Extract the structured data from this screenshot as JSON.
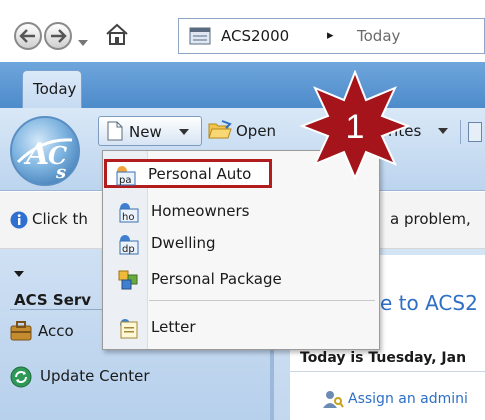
{
  "address_bar": {
    "app": "ACS2000",
    "separator": "▸",
    "location": "Today"
  },
  "tabs": [
    {
      "label": "Today"
    }
  ],
  "toolbar": {
    "new_label": "New",
    "open_label": "Open",
    "favorites_label": "rites"
  },
  "info_bar": {
    "left_text": "Click th",
    "right_text": "a problem,"
  },
  "menu": {
    "items": [
      {
        "label": "Personal Auto",
        "icon_text": "pa",
        "icon": "personal-auto-icon"
      },
      {
        "label": "Homeowners",
        "icon_text": "ho",
        "icon": "homeowners-icon"
      },
      {
        "label": "Dwelling",
        "icon_text": "dp",
        "icon": "dwelling-icon"
      },
      {
        "label": "Personal Package",
        "icon": "personal-package-icon"
      },
      {
        "label": "Letter",
        "icon": "letter-icon"
      }
    ]
  },
  "left_pane": {
    "section_title": "ACS Serv",
    "accounts_label": "Acco",
    "update_center_label": "Update Center"
  },
  "right_pane": {
    "welcome_text": "e to ACS2",
    "date_text": "Today is Tuesday, Jan",
    "task_text": "Assign an admini"
  },
  "annotation": {
    "step_number": "1",
    "color": "#a5141a"
  },
  "colors": {
    "highlight_border": "#b11c1c",
    "ribbon_blue": "#4d8bcb"
  }
}
